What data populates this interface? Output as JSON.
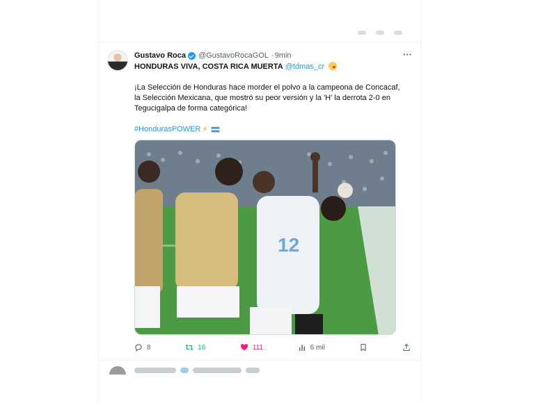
{
  "tweet": {
    "author_name": "Gustavo Roca",
    "handle": "@GustavoRocaGOL",
    "separator": "·",
    "time": "9min",
    "more": "···",
    "headline": "HONDURAS VIVA, COSTA RICA MUERTA",
    "mention": "@tdmas_cr",
    "body": "¡La Selección de Honduras hace morder el polvo a la campeona de Concacaf, la Selección Mexicana, que mostró su peor versión y la 'H' la derrota 2-0 en Tegucigalpa de forma categórica!",
    "hashtag": "#HondurasPOWER",
    "bolt": "⚡",
    "icons": {
      "verified": "verified-badge-icon",
      "emoji": "kissing-face-emoji",
      "flag": "honduras-flag-emoji"
    }
  },
  "actions": {
    "reply_count": "8",
    "retweet_count": "16",
    "like_count": "111",
    "views": "6 mil"
  },
  "colors": {
    "accent": "#1d9bf0",
    "retweet": "#00ba7c",
    "like": "#f91880",
    "muted": "#536471"
  }
}
